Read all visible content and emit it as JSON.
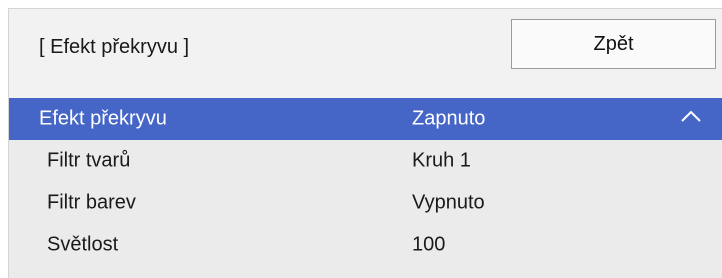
{
  "header": {
    "title": "[ Efekt překryvu ]",
    "back_label": "Zpět"
  },
  "rows": [
    {
      "label": "Efekt překryvu",
      "value": "Zapnuto",
      "selected": true,
      "icon": "chevron-up-icon"
    },
    {
      "label": "Filtr tvarů",
      "value": "Kruh 1"
    },
    {
      "label": "Filtr barev",
      "value": "Vypnuto"
    },
    {
      "label": "Světlost",
      "value": "100"
    }
  ],
  "colors": {
    "selection": "#4566c7",
    "panel": "#ebebeb",
    "header": "#f2f2f2"
  }
}
